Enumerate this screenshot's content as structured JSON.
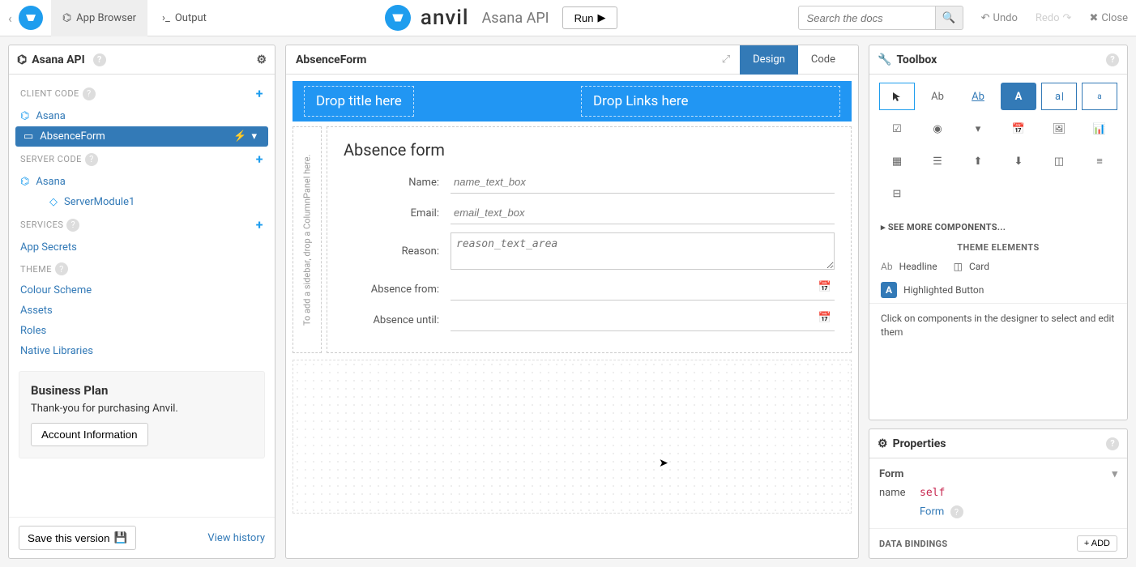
{
  "topbar": {
    "app_browser": "App Browser",
    "output": "Output",
    "brand": "anvil",
    "app_name": "Asana API",
    "run": "Run",
    "search_placeholder": "Search the docs",
    "undo": "Undo",
    "redo": "Redo",
    "close": "Close"
  },
  "sidebar": {
    "title": "Asana API",
    "sections": {
      "client_code": "CLIENT CODE",
      "server_code": "SERVER CODE",
      "services": "SERVICES",
      "theme": "THEME"
    },
    "items": {
      "asana_client": "Asana",
      "absence_form": "AbsenceForm",
      "asana_server": "Asana",
      "server_module": "ServerModule1",
      "app_secrets": "App Secrets",
      "colour_scheme": "Colour Scheme",
      "assets": "Assets",
      "roles": "Roles",
      "native_libraries": "Native Libraries"
    },
    "plan": {
      "title": "Business Plan",
      "text": "Thank-you for purchasing Anvil.",
      "button": "Account Information"
    },
    "save": "Save this version",
    "history": "View history"
  },
  "center": {
    "title": "AbsenceForm",
    "tabs": {
      "design": "Design",
      "code": "Code"
    },
    "drop_title": "Drop title here",
    "drop_links": "Drop Links here",
    "sidebar_hint": "To add a sidebar, drop a ColumnPanel here.",
    "form": {
      "heading": "Absence form",
      "fields": [
        {
          "label": "Name:",
          "placeholder": "name_text_box",
          "type": "text"
        },
        {
          "label": "Email:",
          "placeholder": "email_text_box",
          "type": "text"
        },
        {
          "label": "Reason:",
          "placeholder": "reason_text_area",
          "type": "textarea"
        },
        {
          "label": "Absence from:",
          "placeholder": "",
          "type": "date"
        },
        {
          "label": "Absence until:",
          "placeholder": "",
          "type": "date"
        }
      ]
    }
  },
  "toolbox": {
    "title": "Toolbox",
    "see_more": "SEE MORE COMPONENTS...",
    "theme_elements": "THEME ELEMENTS",
    "headline": "Headline",
    "card": "Card",
    "highlighted_button": "Highlighted Button",
    "hint": "Click on components in the designer to select and edit them",
    "tools": {
      "label": "Ab",
      "link": "Ab",
      "button": "A",
      "textbox": "a",
      "textarea": "a"
    }
  },
  "properties": {
    "title": "Properties",
    "section": "Form",
    "name_label": "name",
    "name_value": "self",
    "form_link": "Form",
    "bindings": "DATA BINDINGS",
    "add": "+ ADD"
  }
}
